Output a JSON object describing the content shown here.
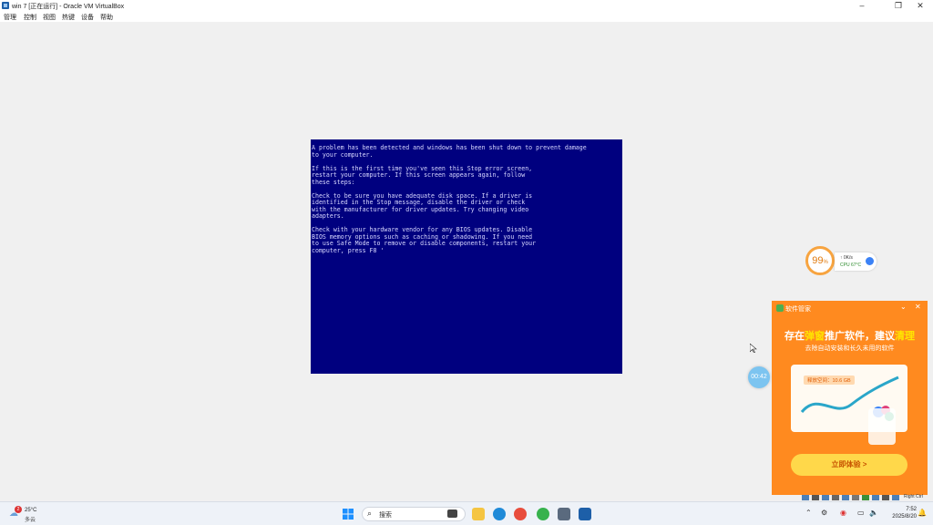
{
  "window": {
    "title": "win 7 [正在运行] - Oracle VM VirtualBox",
    "controls": {
      "minimize": "–",
      "maximize": "❐",
      "close": "✕"
    }
  },
  "menu": [
    "管理",
    "控制",
    "视图",
    "热键",
    "设备",
    "帮助"
  ],
  "bsod": {
    "text": "A problem has been detected and windows has been shut down to prevent damage\nto your computer.\n\nIf this is the first time you've seen this Stop error screen,\nrestart your computer. If this screen appears again, follow\nthese steps:\n\nCheck to be sure you have adequate disk space. If a driver is\nidentified in the Stop message, disable the driver or check\nwith the manufacturer for driver updates. Try changing video\nadapters.\n\nCheck with your hardware vendor for any BIOS updates. Disable\nBIOS memory options such as caching or shadowing. If you need\nto use Safe Mode to remove or disable components, restart your\ncomputer, press F8 '"
  },
  "widget": {
    "gauge_value": "99",
    "gauge_unit": "%",
    "net_speed": "0K/s",
    "net_arrow": "↑",
    "cpu_label": "CPU",
    "cpu_temp": "67°C",
    "timer": "00:42"
  },
  "popup": {
    "brand": "软件管家",
    "minimize": "⌄",
    "close": "✕",
    "headline_pre": "存在",
    "headline_hl1": "弹窗",
    "headline_mid": "推广软件，建议",
    "headline_hl2": "清理",
    "subtitle": "去除自动安装和长久未用的软件",
    "chip": "释放空间：10.6 GB",
    "cta": "立即体验 >"
  },
  "taskbar": {
    "weather_badge": "2",
    "temperature": "25°C",
    "condition": "多云",
    "search_placeholder": "搜索",
    "time": "7:52",
    "date": "2025/8/20",
    "tray_text": "Right Ctrl"
  },
  "colors": {
    "bsod_bg": "#00007f",
    "popup_bg": "#ff8a1f",
    "cta_bg": "#ffd84a",
    "highlight": "#ffe600"
  }
}
